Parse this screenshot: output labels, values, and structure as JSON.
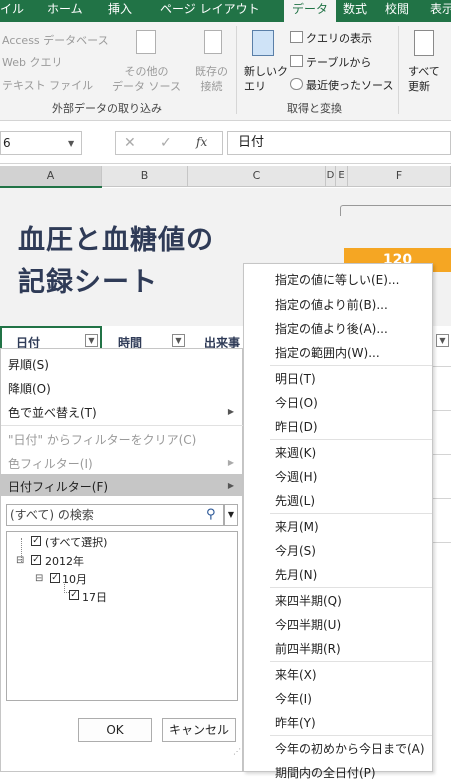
{
  "ribbon": {
    "tabs": [
      "イル",
      "ホーム",
      "挿入",
      "ページ レイアウト",
      "データ",
      "数式",
      "校閲",
      "表示"
    ],
    "active_tab": "データ",
    "external": {
      "items": [
        "Access データベース",
        "Web クエリ",
        "テキスト ファイル"
      ],
      "other_sources": "その他の\nデータ ソース",
      "existing": "既存の\n接続",
      "group_label": "外部データの取り込み"
    },
    "transform": {
      "new_query": "新しいク\nエリ",
      "show_query": "クエリの表示",
      "from_table": "テーブルから",
      "recent_sources": "最近使ったソース",
      "group_label": "取得と変換"
    },
    "refresh_all": "すべて\n更新"
  },
  "formula_bar": {
    "name_box": "6",
    "cancel": "✕",
    "enter": "✓",
    "fx": "fx",
    "content": "日付"
  },
  "columns": [
    "A",
    "B",
    "C",
    "D",
    "E",
    "F"
  ],
  "sheet": {
    "title_line1": "血圧と血糖値の",
    "title_line2": "記録シート",
    "orange_value": "120",
    "headers": [
      "日付",
      "時間",
      "出来事"
    ]
  },
  "filter_menu": {
    "sort_asc": "昇順(S)",
    "sort_desc": "降順(O)",
    "sort_color": "色で並べ替え(T)",
    "clear_filter": "\"日付\" からフィルターをクリア(C)",
    "color_filter": "色フィルター(I)",
    "date_filter": "日付フィルター(F)",
    "search_placeholder": "(すべて) の検索",
    "tree": [
      "(すべて選択)",
      "2012年",
      "10月",
      "17日"
    ],
    "ok": "OK",
    "cancel": "キャンセル"
  },
  "date_filter_submenu": {
    "groups": [
      [
        "指定の値に等しい(E)...",
        "指定の値より前(B)...",
        "指定の値より後(A)...",
        "指定の範囲内(W)..."
      ],
      [
        "明日(T)",
        "今日(O)",
        "昨日(D)"
      ],
      [
        "来週(K)",
        "今週(H)",
        "先週(L)"
      ],
      [
        "来月(M)",
        "今月(S)",
        "先月(N)"
      ],
      [
        "来四半期(Q)",
        "今四半期(U)",
        "前四半期(R)"
      ],
      [
        "来年(X)",
        "今年(I)",
        "昨年(Y)"
      ],
      [
        "今年の初めから今日まで(A)",
        "期間内の全日付(P)"
      ]
    ]
  },
  "colors": {
    "excel_green": "#217346",
    "title_navy": "#2f3b57",
    "orange": "#f5a623",
    "selected_row": "#c6c6c6"
  }
}
